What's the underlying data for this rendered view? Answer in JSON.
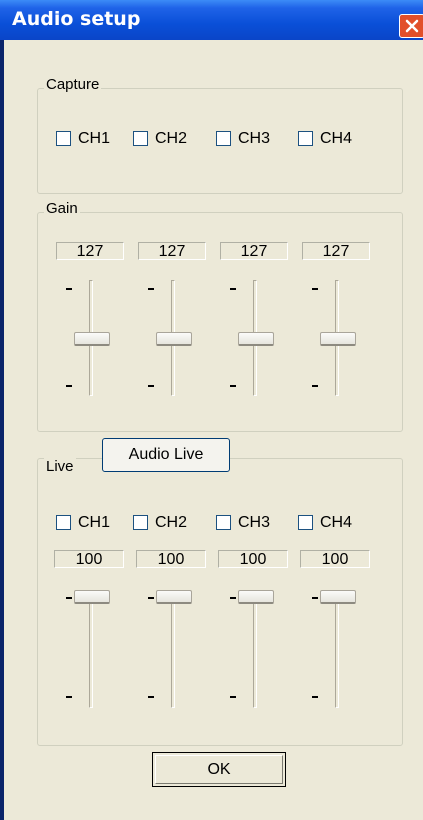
{
  "window": {
    "title": "Audio setup"
  },
  "capture": {
    "label": "Capture",
    "channels": [
      {
        "label": "CH1",
        "checked": false
      },
      {
        "label": "CH2",
        "checked": false
      },
      {
        "label": "CH3",
        "checked": false
      },
      {
        "label": "CH4",
        "checked": false
      }
    ]
  },
  "gain": {
    "label": "Gain",
    "sliders": [
      {
        "value": "127",
        "top_tick": "-",
        "bottom_tick": "-"
      },
      {
        "value": "127",
        "top_tick": "-",
        "bottom_tick": "-"
      },
      {
        "value": "127",
        "top_tick": "-",
        "bottom_tick": "-"
      },
      {
        "value": "127",
        "top_tick": "-",
        "bottom_tick": "-"
      }
    ]
  },
  "live": {
    "label": "Live",
    "button_label": "Audio Live",
    "channels": [
      {
        "label": "CH1",
        "checked": false
      },
      {
        "label": "CH2",
        "checked": false
      },
      {
        "label": "CH3",
        "checked": false
      },
      {
        "label": "CH4",
        "checked": false
      }
    ],
    "sliders": [
      {
        "value": "100"
      },
      {
        "value": "100"
      },
      {
        "value": "100"
      },
      {
        "value": "100"
      }
    ]
  },
  "ok_label": "OK",
  "colors": {
    "titlebar": "#0a4fd8",
    "close": "#e24f2a",
    "dialog_bg": "#ece9d8"
  }
}
